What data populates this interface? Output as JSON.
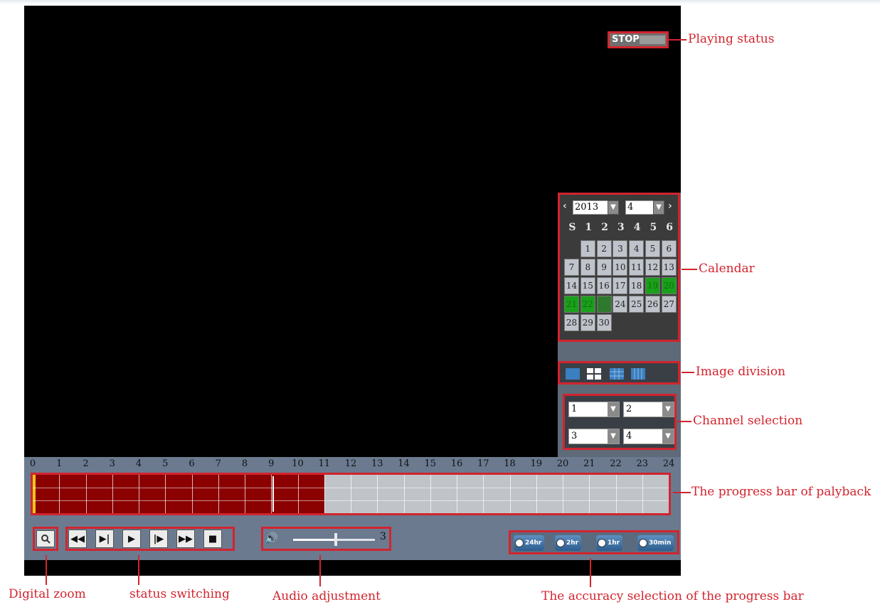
{
  "player": {
    "play_status": "STOP",
    "calendar": {
      "year": "2013",
      "month": "4",
      "prev": "‹",
      "next": "›",
      "weekdays": [
        "S",
        "1",
        "2",
        "3",
        "4",
        "5",
        "6"
      ],
      "days": [
        {
          "d": "",
          "t": "empty"
        },
        {
          "d": "1",
          "t": "n"
        },
        {
          "d": "2",
          "t": "n"
        },
        {
          "d": "3",
          "t": "n"
        },
        {
          "d": "4",
          "t": "n"
        },
        {
          "d": "5",
          "t": "n"
        },
        {
          "d": "6",
          "t": "n"
        },
        {
          "d": "7",
          "t": "n"
        },
        {
          "d": "8",
          "t": "n"
        },
        {
          "d": "9",
          "t": "n"
        },
        {
          "d": "10",
          "t": "n"
        },
        {
          "d": "11",
          "t": "n"
        },
        {
          "d": "12",
          "t": "n"
        },
        {
          "d": "13",
          "t": "n"
        },
        {
          "d": "14",
          "t": "n"
        },
        {
          "d": "15",
          "t": "n"
        },
        {
          "d": "16",
          "t": "n"
        },
        {
          "d": "17",
          "t": "n"
        },
        {
          "d": "18",
          "t": "n"
        },
        {
          "d": "19",
          "t": "rec"
        },
        {
          "d": "20",
          "t": "rec"
        },
        {
          "d": "21",
          "t": "rec"
        },
        {
          "d": "22",
          "t": "rec"
        },
        {
          "d": "23",
          "t": "sel"
        },
        {
          "d": "24",
          "t": "n"
        },
        {
          "d": "25",
          "t": "n"
        },
        {
          "d": "26",
          "t": "n"
        },
        {
          "d": "27",
          "t": "n"
        },
        {
          "d": "28",
          "t": "n"
        },
        {
          "d": "29",
          "t": "n"
        },
        {
          "d": "30",
          "t": "n"
        }
      ]
    },
    "image_division_buttons": [
      "single-view-icon",
      "quad-view-icon",
      "nine-view-icon",
      "sixteen-view-icon"
    ],
    "channels": [
      "1",
      "2",
      "3",
      "4"
    ],
    "timeline": {
      "hours": [
        "0",
        "1",
        "2",
        "3",
        "4",
        "5",
        "6",
        "7",
        "8",
        "9",
        "10",
        "11",
        "12",
        "13",
        "14",
        "15",
        "16",
        "17",
        "18",
        "19",
        "20",
        "21",
        "22",
        "23",
        "24"
      ],
      "recorded_until_hour": 11,
      "marker_hour": 9
    },
    "controls": {
      "zoom_icon": "magnifier-icon",
      "status_buttons": [
        {
          "name": "rewind-button",
          "glyph": "◀◀"
        },
        {
          "name": "step-back-button",
          "glyph": "▶|"
        },
        {
          "name": "play-button",
          "glyph": "▶"
        },
        {
          "name": "step-forward-button",
          "glyph": "|▶"
        },
        {
          "name": "fast-forward-button",
          "glyph": "▶▶"
        },
        {
          "name": "stop-button",
          "glyph": "■"
        }
      ],
      "speaker_icon": "🔊",
      "volume_value": "3",
      "volume_level_fraction": 0.52,
      "accuracy_buttons": [
        "24hr",
        "2hr",
        "1hr",
        "30min"
      ]
    }
  },
  "annotations": {
    "playing_status": "Playing status",
    "calendar": "Calendar",
    "image_division": "Image division",
    "channel_selection": "Channel selection",
    "progress_bar": "The progress bar of palyback",
    "digital_zoom": "Digital zoom",
    "status_switching": "status switching",
    "audio_adjustment": "Audio adjustment",
    "accuracy_selection": "The accuracy selection of the progress bar"
  },
  "colors": {
    "annotation_red": "#d2242e",
    "recorded": "#8b0000",
    "record_day": "#1aa01a",
    "panel": "#6b7a8f"
  }
}
